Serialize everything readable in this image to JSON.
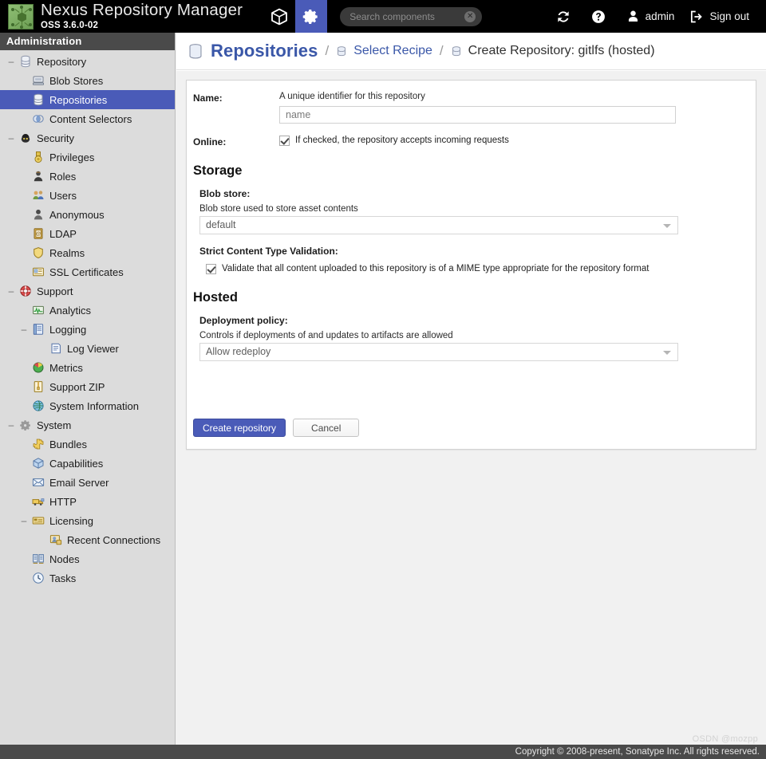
{
  "header": {
    "brand_title": "Nexus Repository Manager",
    "brand_version": "OSS 3.6.0-02",
    "logo_icon": "nexus-logo-icon",
    "tabs": [
      {
        "icon": "cube-icon",
        "name": "browse"
      },
      {
        "icon": "gear-icon",
        "name": "administration",
        "active": true
      }
    ],
    "search": {
      "placeholder": "Search components",
      "value": "",
      "clear_icon": "clear-circle-icon"
    },
    "actions": [
      {
        "label": "",
        "icon": "refresh-icon",
        "name": "refresh"
      },
      {
        "label": "",
        "icon": "help-circle-icon",
        "name": "help"
      },
      {
        "label": "admin",
        "icon": "user-icon",
        "name": "user"
      },
      {
        "label": "Sign out",
        "icon": "sign-out-icon",
        "name": "sign-out"
      }
    ]
  },
  "sidebar": {
    "title": "Administration",
    "items": [
      {
        "label": "Repository",
        "level": 0,
        "icon": "database-icon",
        "toggle": "–",
        "selected": false
      },
      {
        "label": "Blob Stores",
        "level": 1,
        "icon": "blobstore-icon",
        "toggle": "",
        "selected": false
      },
      {
        "label": "Repositories",
        "level": 1,
        "icon": "database-icon",
        "toggle": "",
        "selected": true
      },
      {
        "label": "Content Selectors",
        "level": 1,
        "icon": "selector-icon",
        "toggle": "",
        "selected": false
      },
      {
        "label": "Security",
        "level": 0,
        "icon": "security-icon",
        "toggle": "–",
        "selected": false
      },
      {
        "label": "Privileges",
        "level": 1,
        "icon": "privilege-icon",
        "toggle": "",
        "selected": false
      },
      {
        "label": "Roles",
        "level": 1,
        "icon": "role-icon",
        "toggle": "",
        "selected": false
      },
      {
        "label": "Users",
        "level": 1,
        "icon": "users-icon",
        "toggle": "",
        "selected": false
      },
      {
        "label": "Anonymous",
        "level": 1,
        "icon": "anonymous-icon",
        "toggle": "",
        "selected": false
      },
      {
        "label": "LDAP",
        "level": 1,
        "icon": "ldap-icon",
        "toggle": "",
        "selected": false
      },
      {
        "label": "Realms",
        "level": 1,
        "icon": "realms-icon",
        "toggle": "",
        "selected": false
      },
      {
        "label": "SSL Certificates",
        "level": 1,
        "icon": "certificate-icon",
        "toggle": "",
        "selected": false
      },
      {
        "label": "Support",
        "level": 0,
        "icon": "lifering-icon",
        "toggle": "–",
        "selected": false
      },
      {
        "label": "Analytics",
        "level": 1,
        "icon": "analytics-icon",
        "toggle": "",
        "selected": false
      },
      {
        "label": "Logging",
        "level": 1,
        "icon": "logging-icon",
        "toggle": "–",
        "selected": false
      },
      {
        "label": "Log Viewer",
        "level": 2,
        "icon": "logviewer-icon",
        "toggle": "",
        "selected": false
      },
      {
        "label": "Metrics",
        "level": 1,
        "icon": "metrics-icon",
        "toggle": "",
        "selected": false
      },
      {
        "label": "Support ZIP",
        "level": 1,
        "icon": "supportzip-icon",
        "toggle": "",
        "selected": false
      },
      {
        "label": "System Information",
        "level": 1,
        "icon": "sysinfo-icon",
        "toggle": "",
        "selected": false
      },
      {
        "label": "System",
        "level": 0,
        "icon": "gear-icon",
        "toggle": "–",
        "selected": false
      },
      {
        "label": "Bundles",
        "level": 1,
        "icon": "puzzle-icon",
        "toggle": "",
        "selected": false
      },
      {
        "label": "Capabilities",
        "level": 1,
        "icon": "capabilities-icon",
        "toggle": "",
        "selected": false
      },
      {
        "label": "Email Server",
        "level": 1,
        "icon": "email-icon",
        "toggle": "",
        "selected": false
      },
      {
        "label": "HTTP",
        "level": 1,
        "icon": "http-icon",
        "toggle": "",
        "selected": false
      },
      {
        "label": "Licensing",
        "level": 1,
        "icon": "license-icon",
        "toggle": "–",
        "selected": false
      },
      {
        "label": "Recent Connections",
        "level": 2,
        "icon": "connections-icon",
        "toggle": "",
        "selected": false
      },
      {
        "label": "Nodes",
        "level": 1,
        "icon": "nodes-icon",
        "toggle": "",
        "selected": false
      },
      {
        "label": "Tasks",
        "level": 1,
        "icon": "tasks-icon",
        "toggle": "",
        "selected": false
      }
    ]
  },
  "breadcrumb": {
    "root": "Repositories",
    "root_icon": "database-icon",
    "separator": "/",
    "step2": "Select Recipe",
    "step2_icon": "database-icon",
    "current": "Create Repository: gitlfs (hosted)",
    "current_icon": "database-icon"
  },
  "form": {
    "name_label": "Name:",
    "name_help": "A unique identifier for this repository",
    "name_placeholder": "name",
    "name_value": "",
    "online_label": "Online:",
    "online_checked": true,
    "online_help": "If checked, the repository accepts incoming requests",
    "storage_heading": "Storage",
    "blob_store_label": "Blob store:",
    "blob_store_help": "Blob store used to store asset contents",
    "blob_store_value": "default",
    "strict_label": "Strict Content Type Validation:",
    "strict_checked": true,
    "strict_help": "Validate that all content uploaded to this repository is of a MIME type appropriate for the repository format",
    "hosted_heading": "Hosted",
    "deployment_label": "Deployment policy:",
    "deployment_help": "Controls if deployments of and updates to artifacts are allowed",
    "deployment_value": "Allow redeploy",
    "create_button": "Create repository",
    "cancel_button": "Cancel"
  },
  "footer": {
    "copyright": "Copyright © 2008-present, Sonatype Inc. All rights reserved.",
    "watermark": "OSDN @mozpp"
  },
  "colors": {
    "accent": "#4a5bb8",
    "link": "#3a57a8",
    "header_bg": "#000000",
    "sidebar_bg": "#dcdcdc",
    "footer_bg": "#4a4a4a"
  }
}
